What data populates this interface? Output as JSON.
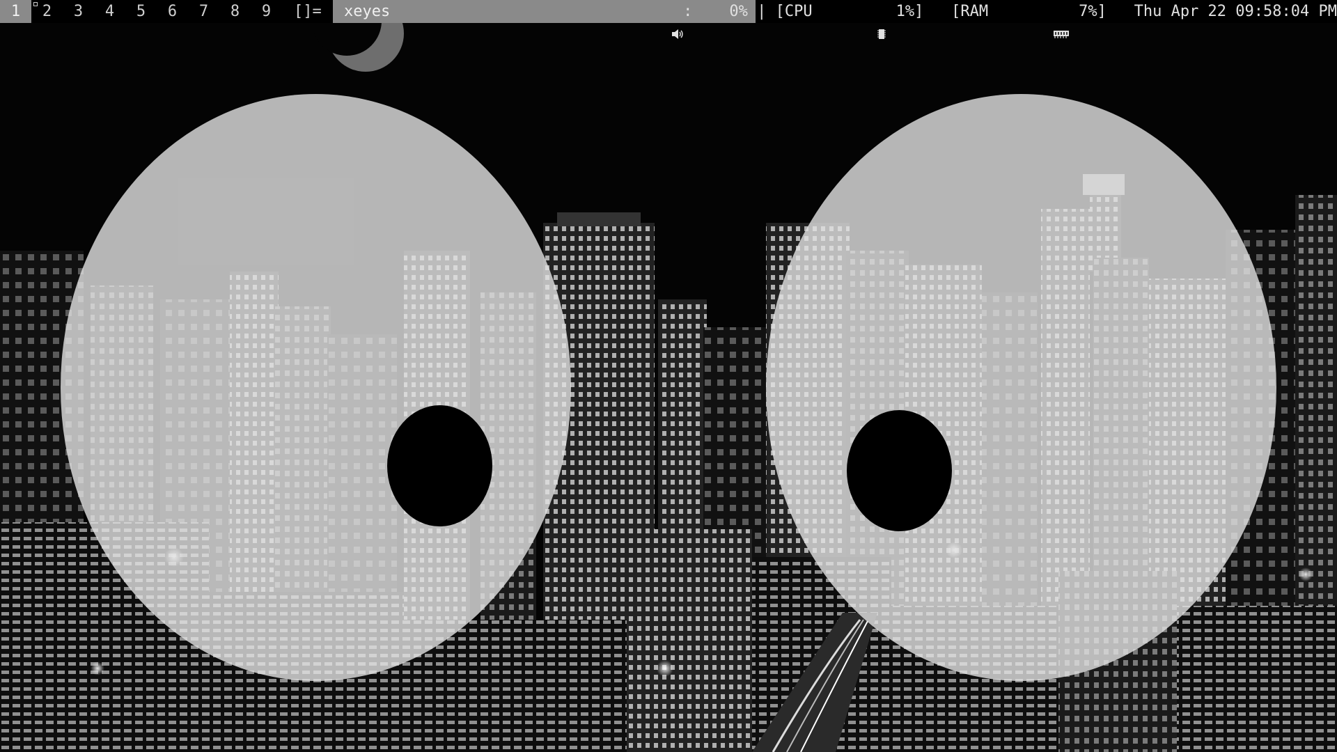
{
  "bar": {
    "tags": [
      "1",
      "2",
      "3",
      "4",
      "5",
      "6",
      "7",
      "8",
      "9"
    ],
    "active_tag": "1",
    "layout_symbol": "[]=",
    "window_title": "xeyes",
    "volume": "0%",
    "separator": "|",
    "cpu_label": "[CPU",
    "cpu_value": "1%]",
    "ram_label": "[RAM",
    "ram_value": "7%]",
    "datetime": "Thu Apr 22 09:58:04 PM"
  },
  "icons": {
    "volume": "speaker-icon",
    "cpu": "chip-icon",
    "ram": "memory-icon"
  },
  "colors": {
    "bar_bg": "#000000",
    "bar_fg": "#d8d8d8",
    "selected_bg": "#8a8a8a",
    "eye_white": "#e4e4e4",
    "pupil": "#000000"
  },
  "application": {
    "name": "xeyes"
  }
}
